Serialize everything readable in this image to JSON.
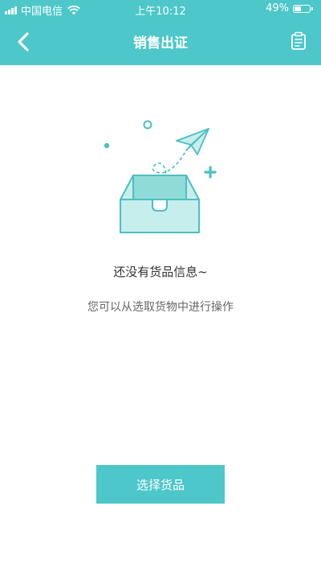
{
  "status_bar": {
    "carrier": "中国电信",
    "time": "上午10:12",
    "battery_percent": "49%",
    "battery_level": 0.49
  },
  "nav": {
    "title": "销售出证",
    "back_icon": "chevron-left-icon",
    "right_icon": "clipboard-icon"
  },
  "empty_state": {
    "illustration": "empty-box-paper-plane-illustration",
    "title": "还没有货品信息~",
    "hint": "您可以从选取货物中进行操作"
  },
  "actions": {
    "select_goods_label": "选择货品"
  },
  "colors": {
    "accent": "#4dc7c9",
    "illustration_fill": "#c6eeec",
    "illustration_stroke": "#4cbfc2"
  }
}
